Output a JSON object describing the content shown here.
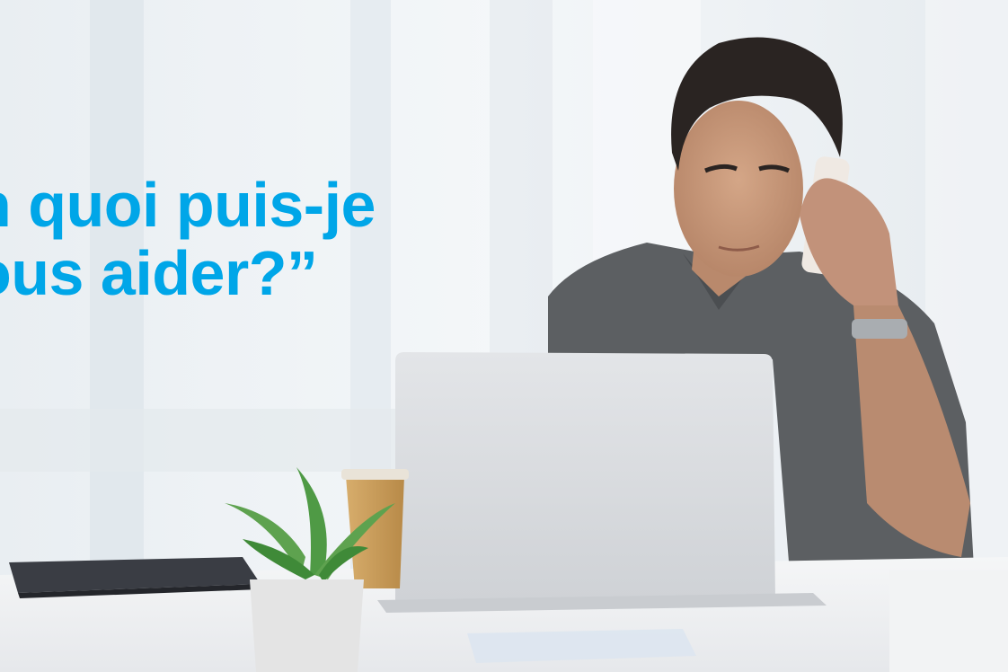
{
  "headline": {
    "line1": "n quoi puis-je",
    "line2": "ous aider?”",
    "color": "#00a6e8"
  },
  "scene": {
    "subject": "man-on-phone-at-laptop",
    "palette": {
      "background": "#eef2f5",
      "window_light": "#f8fafb",
      "shirt": "#5c5f62",
      "skin": "#c89a7c",
      "hair": "#2a2422",
      "laptop": "#dcdee1",
      "desk": "#f3f4f6",
      "cup": "#c79a5a",
      "plant": "#4f9a45",
      "pot": "#e4e4e4"
    }
  }
}
